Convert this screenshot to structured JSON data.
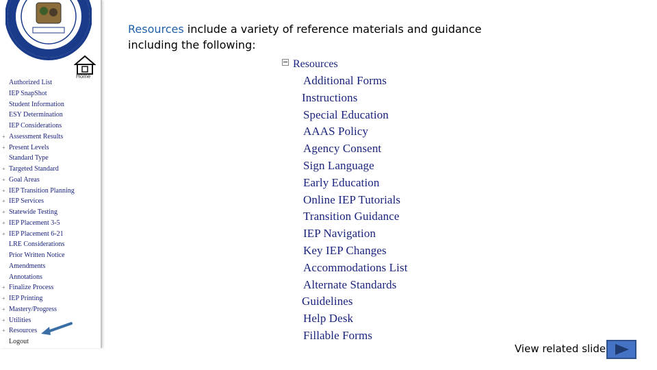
{
  "sidebar": {
    "home_label": "Home",
    "items": [
      {
        "label": "Authorized List",
        "expandable": false
      },
      {
        "label": "IEP SnapShot",
        "expandable": false
      },
      {
        "label": "Student Information",
        "expandable": false
      },
      {
        "label": "ESY Determination",
        "expandable": false
      },
      {
        "label": "IEP Considerations",
        "expandable": false
      },
      {
        "label": "Assessment Results",
        "expandable": true
      },
      {
        "label": "Present Levels",
        "expandable": true
      },
      {
        "label": "Standard Type",
        "expandable": false
      },
      {
        "label": "Targeted Standard",
        "expandable": true
      },
      {
        "label": "Goal Areas",
        "expandable": true
      },
      {
        "label": "IEP Transition Planning",
        "expandable": true
      },
      {
        "label": "IEP Services",
        "expandable": true
      },
      {
        "label": "Statewide Testing",
        "expandable": true
      },
      {
        "label": "IEP Placement 3-5",
        "expandable": true
      },
      {
        "label": "IEP Placement 6-21",
        "expandable": true
      },
      {
        "label": "LRE Considerations",
        "expandable": false
      },
      {
        "label": "Prior Written Notice",
        "expandable": false
      },
      {
        "label": "Amendments",
        "expandable": false
      },
      {
        "label": "Annotations",
        "expandable": false
      },
      {
        "label": "Finalize Process",
        "expandable": true
      },
      {
        "label": "IEP Printing",
        "expandable": true
      },
      {
        "label": "Mastery/Progress",
        "expandable": true
      },
      {
        "label": "Utilities",
        "expandable": true
      },
      {
        "label": "Resources",
        "expandable": true
      },
      {
        "label": "Logout",
        "expandable": false
      }
    ]
  },
  "intro": {
    "highlight": "Resources",
    "line1_rest": " include a variety of  reference materials and guidance",
    "line2": "including the following:"
  },
  "resources": {
    "root_label": "Resources",
    "items": [
      "Additional Forms",
      "Instructions",
      "Special Education",
      "AAAS Policy",
      "Agency Consent",
      "Sign Language",
      "Early Education",
      "Online IEP Tutorials",
      "Transition Guidance",
      "IEP Navigation",
      "Key IEP Changes",
      "Accommodations List",
      "Alternate Standards",
      "Guidelines",
      "Help Desk",
      "Fillable Forms"
    ]
  },
  "footer": {
    "related_label": "View related slide"
  },
  "colors": {
    "link": "#1a237e",
    "accent": "#1f5fa8",
    "button": "#4472c4",
    "arrow": "#3a6ea5"
  }
}
